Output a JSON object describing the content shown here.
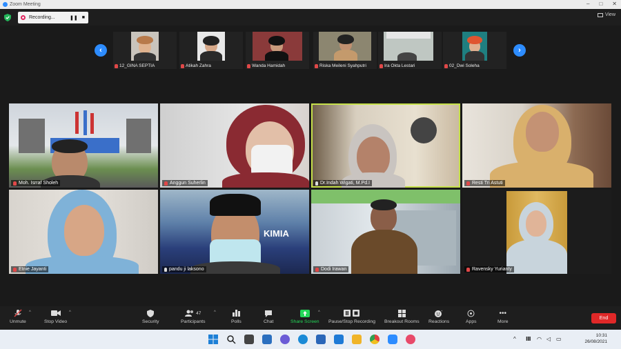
{
  "window": {
    "title": "Zoom Meeting"
  },
  "recording": {
    "label": "Recording...",
    "pause": "❚❚",
    "stop": "■"
  },
  "view_label": "View",
  "strip": [
    {
      "name": "12_GINA SEPTIA"
    },
    {
      "name": "Atikah Zahra"
    },
    {
      "name": "Wanda Hamidah"
    },
    {
      "name": "Riska Meileni Syahputri"
    },
    {
      "name": "Ira Okta Lestari"
    },
    {
      "name": "02_Dwi Soleha"
    }
  ],
  "grid": [
    {
      "name": "Moh. Isrraf Sholeh"
    },
    {
      "name": "Anggun Suherlin"
    },
    {
      "name": "Dr.Indah Wigati, M.Pd.I"
    },
    {
      "name": "Resti Tri Astuti"
    },
    {
      "name": "Etnie Jayanti"
    },
    {
      "name": "pandu ji laksono"
    },
    {
      "name": "Dodi Irawan"
    },
    {
      "name": "Ravensky Yurianty"
    }
  ],
  "tile_text": {
    "kimia": "KIMIA"
  },
  "toolbar": {
    "unmute": "Unmute",
    "stop_video": "Stop Video",
    "security": "Security",
    "participants": "Participants",
    "participants_count": "47",
    "polls": "Polls",
    "chat": "Chat",
    "share_screen": "Share Screen",
    "pause_recording": "Pause/Stop Recording",
    "breakout": "Breakout Rooms",
    "reactions": "Reactions",
    "apps": "Apps",
    "more": "More",
    "end": "End"
  },
  "tray": {
    "time": "10:31",
    "date": "26/08/2021"
  },
  "colors": {
    "accent": "#2d8cff",
    "end": "#e02828",
    "share": "#23d959",
    "active_speaker": "#c6e04a"
  }
}
